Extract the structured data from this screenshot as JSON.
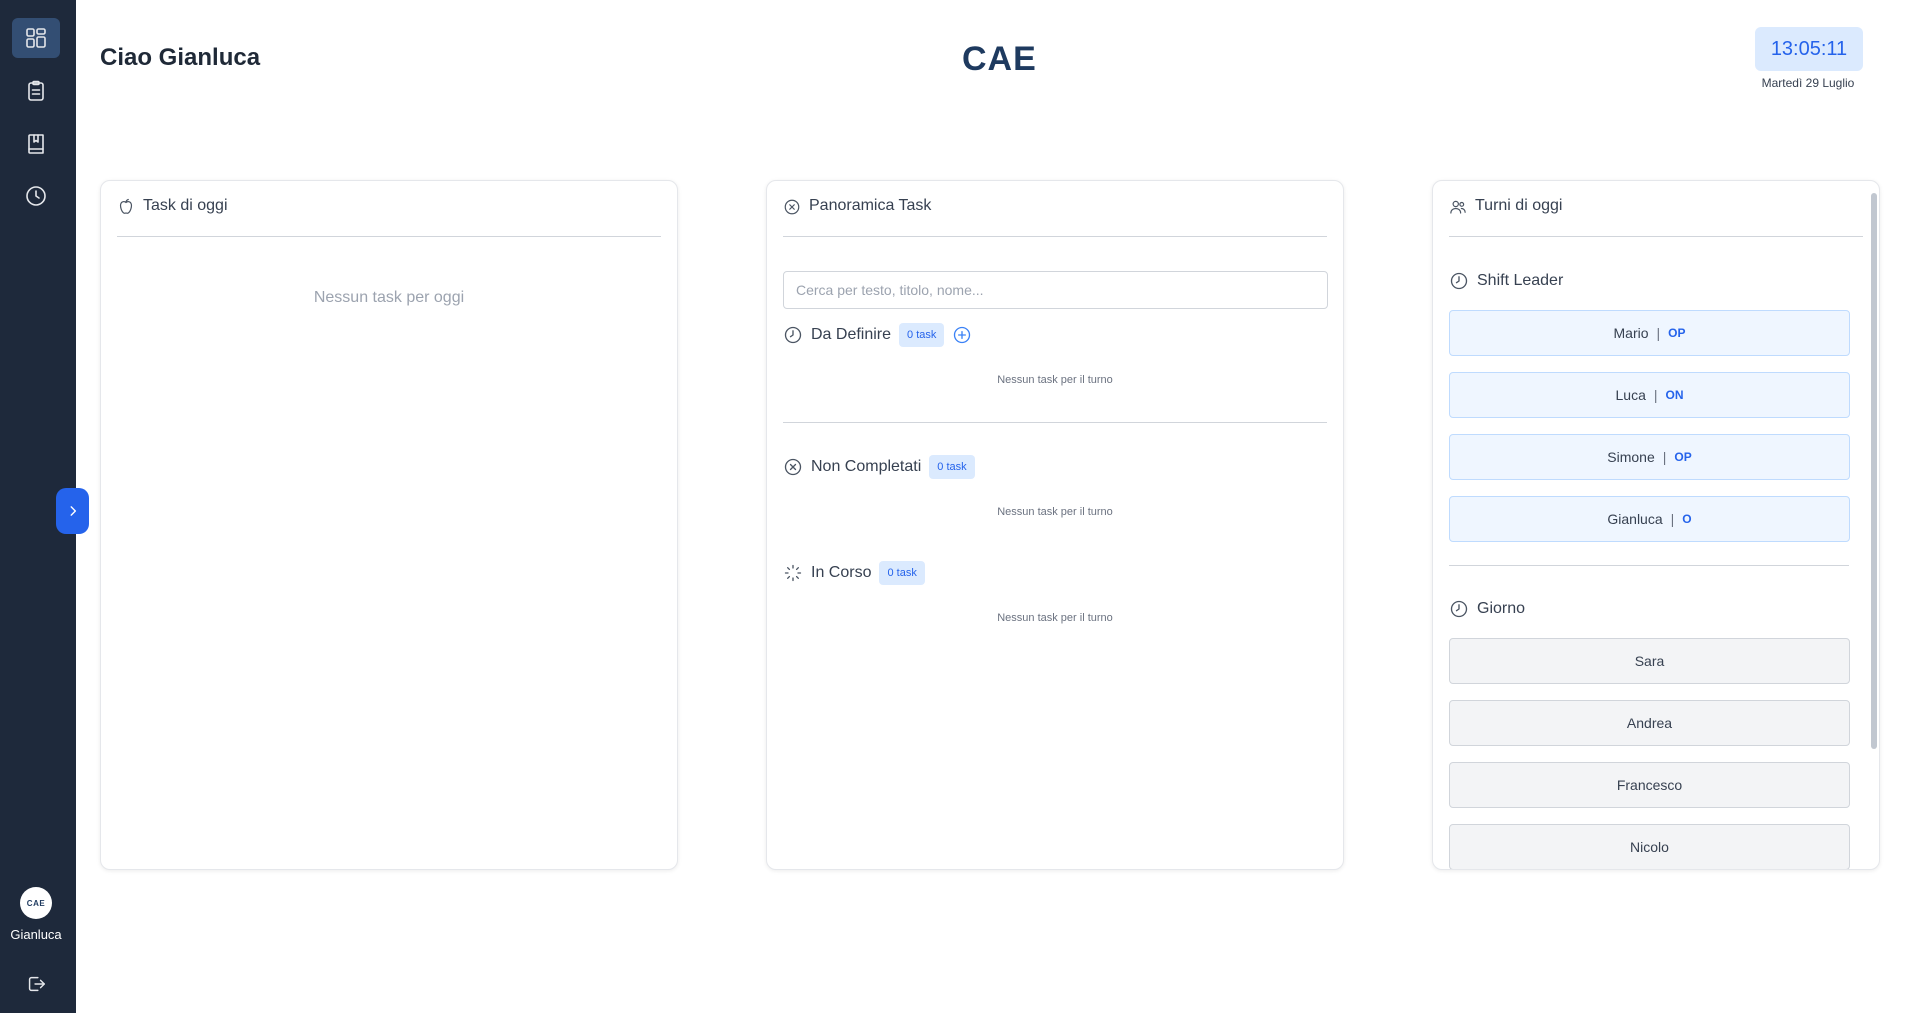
{
  "sidebar": {
    "user": {
      "avatar_text": "CAE",
      "name": "Gianluca"
    }
  },
  "header": {
    "greeting": "Ciao Gianluca",
    "logo": "CAE",
    "time": "13:05:11",
    "date": "Martedì 29 Luglio"
  },
  "tasks_today": {
    "title": "Task di oggi",
    "empty": "Nessun task per oggi"
  },
  "overview": {
    "title": "Panoramica Task",
    "search_placeholder": "Cerca per testo, titolo, nome...",
    "sections": [
      {
        "title": "Da Definire",
        "badge": "0 task",
        "empty": "Nessun task per il turno"
      },
      {
        "title": "Non Completati",
        "badge": "0 task",
        "empty": "Nessun task per il turno"
      },
      {
        "title": "In Corso",
        "badge": "0 task",
        "empty": "Nessun task per il turno"
      }
    ]
  },
  "shifts": {
    "title": "Turni di oggi",
    "leader_title": "Shift Leader",
    "leaders": [
      {
        "name": "Mario",
        "sep": "|",
        "role": "OP"
      },
      {
        "name": "Luca",
        "sep": "|",
        "role": "ON"
      },
      {
        "name": "Simone",
        "sep": "|",
        "role": "OP"
      },
      {
        "name": "Gianluca",
        "sep": "|",
        "role": "O"
      }
    ],
    "day_title": "Giorno",
    "day": [
      {
        "name": "Sara"
      },
      {
        "name": "Andrea"
      },
      {
        "name": "Francesco"
      },
      {
        "name": "Nicolo"
      }
    ]
  },
  "colors": {
    "sidebar": "#1e293b",
    "accent": "#2563eb",
    "badge_bg": "#dbeafe"
  }
}
